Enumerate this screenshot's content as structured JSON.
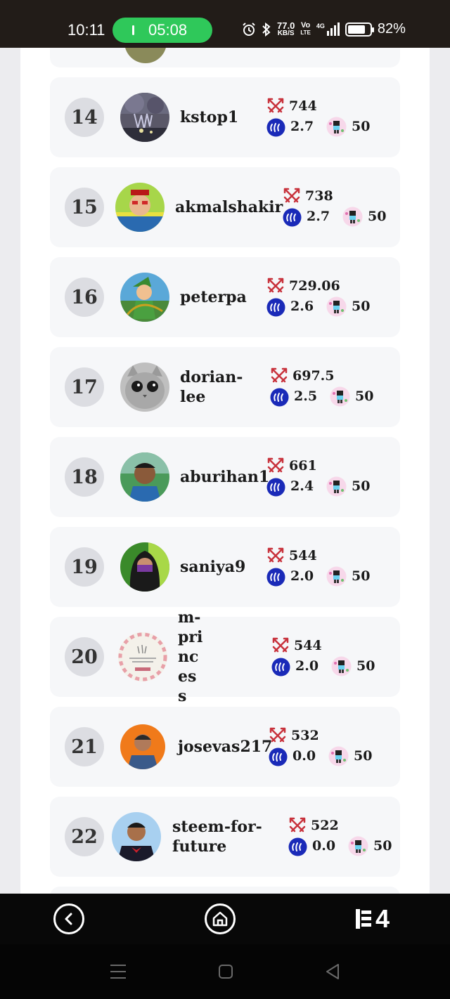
{
  "status_bar": {
    "time": "10:11",
    "call_timer": "05:08",
    "net_speed_value": "77.0",
    "net_speed_unit": "KB/S",
    "volte_top": "Vo",
    "volte_bottom": "LTE",
    "network": "4G",
    "battery_percent": "82%",
    "battery_level": 0.82
  },
  "leaderboard": [
    {
      "rank": "14",
      "username": "kstop1",
      "score": "744",
      "steem_power": "2.7",
      "level": "50"
    },
    {
      "rank": "15",
      "username": "akmalshakir",
      "score": "738",
      "steem_power": "2.7",
      "level": "50"
    },
    {
      "rank": "16",
      "username": "peterpa",
      "score": "729.06",
      "steem_power": "2.6",
      "level": "50"
    },
    {
      "rank": "17",
      "username": "dorian-lee",
      "score": "697.5",
      "steem_power": "2.5",
      "level": "50"
    },
    {
      "rank": "18",
      "username": "aburihan1",
      "score": "661",
      "steem_power": "2.4",
      "level": "50"
    },
    {
      "rank": "19",
      "username": "saniya9",
      "score": "544",
      "steem_power": "2.0",
      "level": "50"
    },
    {
      "rank": "20",
      "username": "m-princess",
      "score": "544",
      "steem_power": "2.0",
      "level": "50"
    },
    {
      "rank": "21",
      "username": "josevas217",
      "score": "532",
      "steem_power": "0.0",
      "level": "50"
    },
    {
      "rank": "22",
      "username": "steem-for-future",
      "score": "522",
      "steem_power": "0.0",
      "level": "50"
    }
  ],
  "app_nav": {
    "logo_text": "4"
  },
  "colors": {
    "status_bar_bg": "#221c18",
    "call_pill": "#2fc85a",
    "card_bg": "#f6f7f9",
    "rank_badge_bg": "#dcdde2",
    "steem_blue": "#1a2ab8",
    "sword_red": "#c8323c"
  }
}
